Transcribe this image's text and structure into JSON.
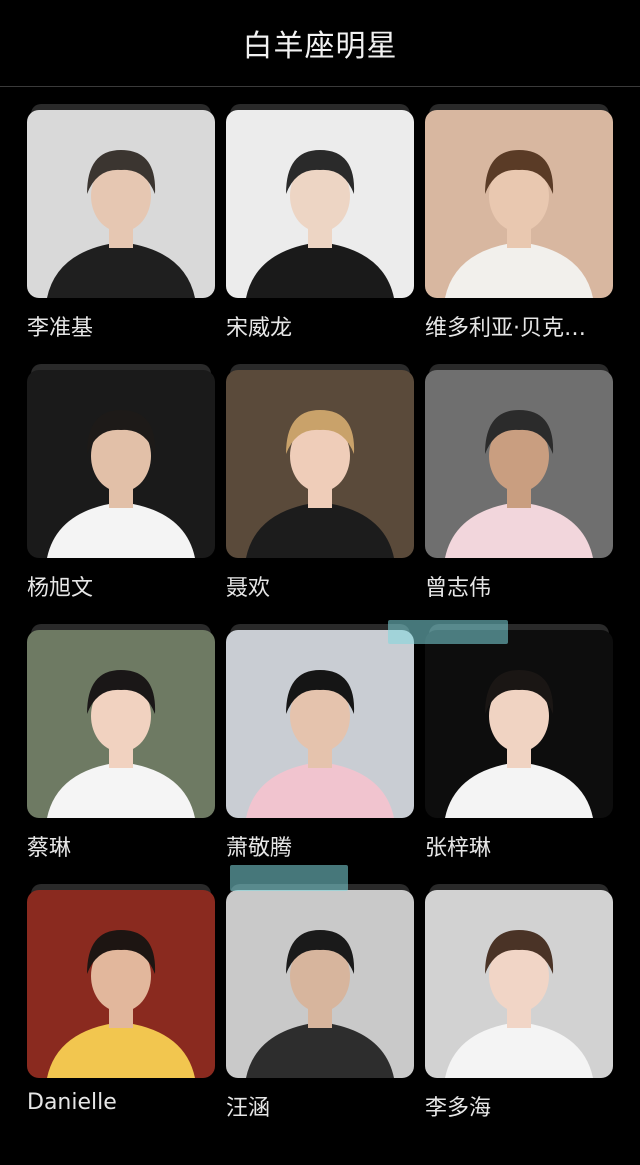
{
  "header": {
    "title": "白羊座明星"
  },
  "celebrities": [
    {
      "name": "李准基",
      "bg": "#d9d9d9",
      "hair": "#3b3530",
      "skin": "#e6c7b2",
      "outfit": "#1f1f1f"
    },
    {
      "name": "宋威龙",
      "bg": "#ececec",
      "hair": "#2a2a2a",
      "skin": "#edd5c4",
      "outfit": "#1a1a1a"
    },
    {
      "name": "维多利亚·贝克…",
      "bg": "#d8b7a0",
      "hair": "#5a3b26",
      "skin": "#e9c8b0",
      "outfit": "#f2f0ec"
    },
    {
      "name": "杨旭文",
      "bg": "#1a1a1a",
      "hair": "#1d1a18",
      "skin": "#e2c0a8",
      "outfit": "#f4f4f4"
    },
    {
      "name": "聂欢",
      "bg": "#5a4a3a",
      "hair": "#c9a26a",
      "skin": "#efcdb9",
      "outfit": "#1c1c1c"
    },
    {
      "name": "曾志伟",
      "bg": "#6f6f6f",
      "hair": "#2b2b2b",
      "skin": "#c99e80",
      "outfit": "#f2d6dc"
    },
    {
      "name": "蔡琳",
      "bg": "#6e7a63",
      "hair": "#1a1717",
      "skin": "#f1d2c0",
      "outfit": "#f5f5f5"
    },
    {
      "name": "萧敬腾",
      "bg": "#c9cdd3",
      "hair": "#151515",
      "skin": "#e5c3ad",
      "outfit": "#f1c4cf"
    },
    {
      "name": "张梓琳",
      "bg": "#0d0d0d",
      "hair": "#1a1614",
      "skin": "#f0d3c2",
      "outfit": "#f4f4f4"
    },
    {
      "name": "Danielle",
      "bg": "#8a2a1f",
      "hair": "#1d1512",
      "skin": "#e2b79c",
      "outfit": "#f2c64f"
    },
    {
      "name": "汪涵",
      "bg": "#c9c9c9",
      "hair": "#1a1a1a",
      "skin": "#d7b59d",
      "outfit": "#2d2d2d"
    },
    {
      "name": "李多海",
      "bg": "#d2d2d2",
      "hair": "#4a3326",
      "skin": "#f1d5c6",
      "outfit": "#f4f4f4"
    }
  ]
}
